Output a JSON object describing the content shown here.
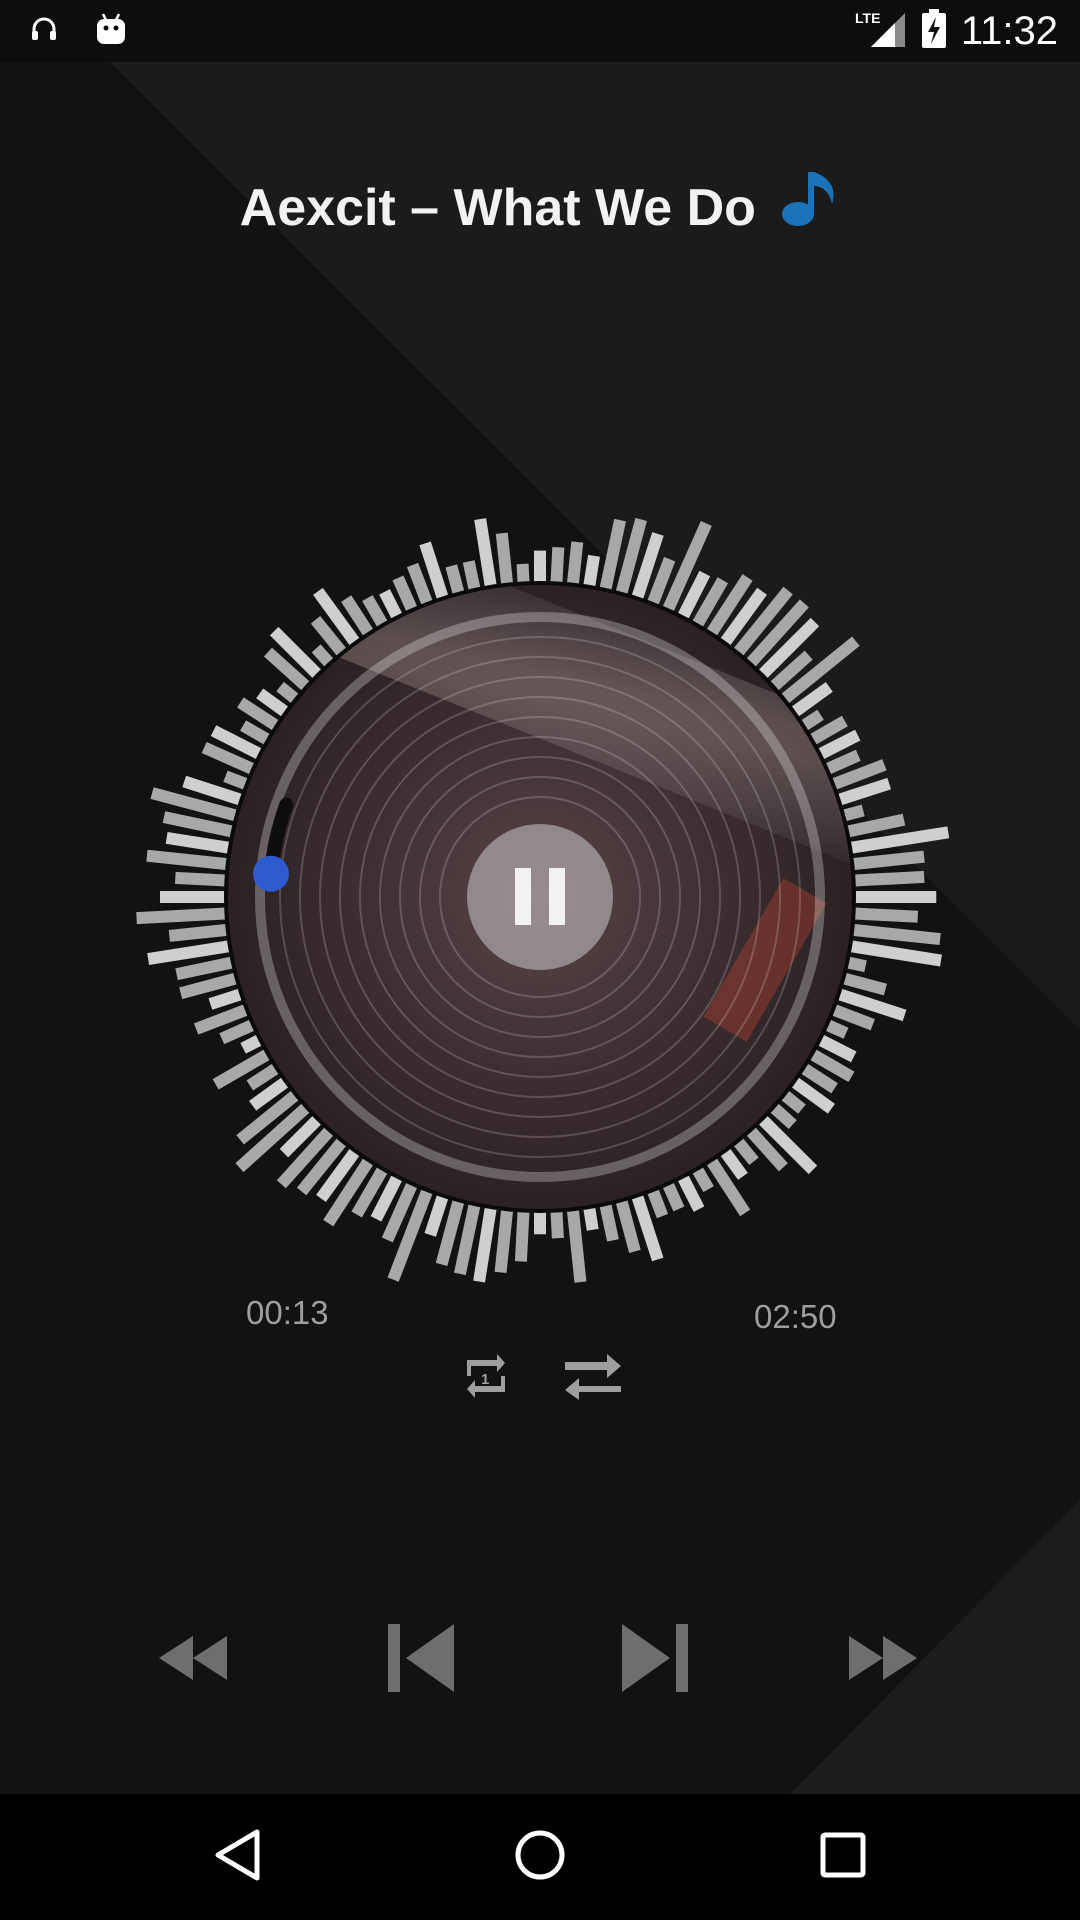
{
  "status_bar": {
    "left_icons": [
      "headphones-icon",
      "android-icon"
    ],
    "network_label": "LTE",
    "time": "11:32"
  },
  "track": {
    "title": "Aexcit – What We Do",
    "note_icon": "music-note-icon",
    "note_color": "#1a73b8"
  },
  "playback": {
    "current_time": "00:13",
    "total_time": "02:50",
    "progress_fraction": 0.076,
    "state_icon": "pause-icon",
    "progress_knob_color": "#2f5bd0"
  },
  "modes": {
    "repeat_icon": "repeat-one-icon",
    "shuffle_icon": "shuffle-icon"
  },
  "transport": {
    "rewind_icon": "rewind-icon",
    "previous_icon": "skip-previous-icon",
    "next_icon": "skip-next-icon",
    "fast_forward_icon": "fast-forward-icon"
  },
  "navigation": {
    "back_icon": "back-triangle-icon",
    "home_icon": "home-circle-icon",
    "recents_icon": "recents-square-icon"
  }
}
